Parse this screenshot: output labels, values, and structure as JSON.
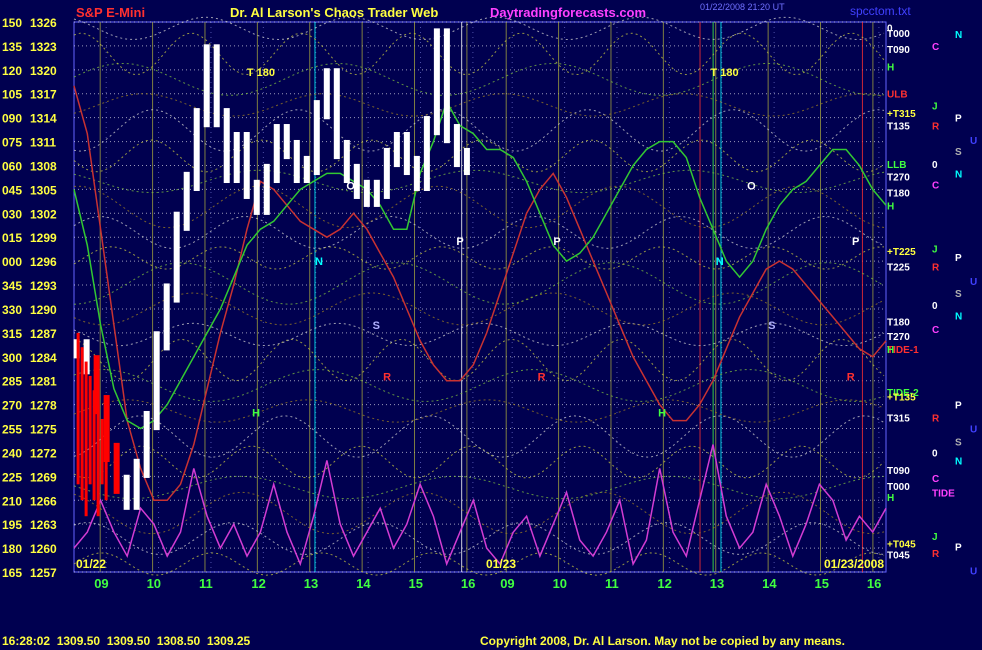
{
  "header": {
    "symbol": "S&P E-Mini",
    "title": "Dr. Al Larson's Chaos Trader Web",
    "site": "Daytradingforecasts.com",
    "timestamp": "01/22/2008 21:20 UT",
    "file": "spcctom.txt"
  },
  "footer": {
    "quote": "16:28:02  1309.50  1309.50  1308.50  1309.25",
    "copyright": "Copyright 2008, Dr. Al Larson. May not be copied by any means."
  },
  "colors": {
    "background": "#000050",
    "grid_vertical": "#B4B43C",
    "grid_horizontal": "#FFFFFF",
    "price_bars": "#FFFFFF",
    "down_bars": "#FF0000",
    "ulb_line": "#C83232",
    "llb_line": "#32C832",
    "tide_line": "#D23CD2"
  },
  "chart_data": {
    "type": "line",
    "title": "S&P E-Mini",
    "ylim": [
      1257,
      1326
    ],
    "y_ticks": [
      {
        "angle": "165",
        "price": "1257"
      },
      {
        "angle": "180",
        "price": "1260"
      },
      {
        "angle": "195",
        "price": "1263"
      },
      {
        "angle": "210",
        "price": "1266"
      },
      {
        "angle": "225",
        "price": "1269"
      },
      {
        "angle": "240",
        "price": "1272"
      },
      {
        "angle": "255",
        "price": "1275"
      },
      {
        "angle": "270",
        "price": "1278"
      },
      {
        "angle": "285",
        "price": "1281"
      },
      {
        "angle": "300",
        "price": "1284"
      },
      {
        "angle": "315",
        "price": "1287"
      },
      {
        "angle": "330",
        "price": "1290"
      },
      {
        "angle": "345",
        "price": "1293"
      },
      {
        "angle": "000",
        "price": "1296"
      },
      {
        "angle": "015",
        "price": "1299"
      },
      {
        "angle": "030",
        "price": "1302"
      },
      {
        "angle": "045",
        "price": "1305"
      },
      {
        "angle": "060",
        "price": "1308"
      },
      {
        "angle": "075",
        "price": "1311"
      },
      {
        "angle": "090",
        "price": "1314"
      },
      {
        "angle": "105",
        "price": "1317"
      },
      {
        "angle": "120",
        "price": "1320"
      },
      {
        "angle": "135",
        "price": "1323"
      },
      {
        "angle": "150",
        "price": "1326"
      }
    ],
    "x_hours": [
      9,
      10,
      11,
      12,
      13,
      14,
      15,
      16,
      9,
      10,
      11,
      12,
      13,
      14,
      15,
      16
    ],
    "x_tick_labels": [
      "09",
      "10",
      "11",
      "12",
      "13",
      "14",
      "15",
      "16",
      "09",
      "10",
      "11",
      "12",
      "13",
      "14",
      "15",
      "16"
    ],
    "date_labels": [
      "01/22",
      "01/23",
      "01/23/2008"
    ],
    "series": [
      {
        "name": "ULB",
        "values": [
          1318,
          1312,
          1300,
          1288,
          1276,
          1270,
          1266,
          1266,
          1268,
          1273,
          1280,
          1287,
          1293,
          1300,
          1306,
          1305,
          1303,
          1301,
          1300,
          1299,
          1300,
          1302,
          1300,
          1297,
          1294,
          1290,
          1286,
          1283,
          1281,
          1281,
          1283,
          1287,
          1292,
          1297,
          1302,
          1305,
          1307,
          1304,
          1300,
          1296,
          1292,
          1288,
          1284,
          1281,
          1278,
          1276,
          1276,
          1278,
          1281,
          1285,
          1289,
          1292,
          1295,
          1296,
          1295,
          1293,
          1291,
          1289,
          1287,
          1285,
          1284,
          1286
        ]
      },
      {
        "name": "LLB",
        "values": [
          1305,
          1298,
          1288,
          1280,
          1276,
          1275,
          1276,
          1278,
          1281,
          1284,
          1287,
          1290,
          1294,
          1298,
          1300,
          1301,
          1303,
          1305,
          1306,
          1307,
          1307,
          1306,
          1305,
          1303,
          1300,
          1300,
          1307,
          1311,
          1316,
          1313,
          1312,
          1310,
          1310,
          1309,
          1306,
          1302,
          1298,
          1296,
          1297,
          1299,
          1302,
          1305,
          1308,
          1310,
          1311,
          1311,
          1309,
          1304,
          1300,
          1296,
          1294,
          1296,
          1300,
          1303,
          1305,
          1306,
          1308,
          1310,
          1310,
          1308,
          1305,
          1303
        ]
      },
      {
        "name": "TIDE",
        "values": [
          1260,
          1262,
          1266,
          1262,
          1259,
          1265,
          1263,
          1259,
          1262,
          1270,
          1264,
          1260,
          1263,
          1259,
          1262,
          1268,
          1262,
          1258,
          1264,
          1271,
          1263,
          1259,
          1262,
          1265,
          1260,
          1263,
          1268,
          1264,
          1258,
          1262,
          1266,
          1260,
          1258,
          1262,
          1264,
          1259,
          1263,
          1267,
          1261,
          1259,
          1262,
          1266,
          1258,
          1261,
          1270,
          1262,
          1259,
          1266,
          1273,
          1264,
          1260,
          1262,
          1268,
          1264,
          1259,
          1263,
          1268,
          1266,
          1261,
          1264,
          1262,
          1265
        ]
      },
      {
        "name": "Price",
        "values": [
          1285,
          1283,
          1278,
          1272,
          1268,
          1266,
          1270,
          1276,
          1286,
          1292,
          1301,
          1306,
          1314,
          1322,
          1314,
          1307,
          1311,
          1305,
          1303,
          1307,
          1312,
          1310,
          1307,
          1308,
          1315,
          1319,
          1310,
          1307,
          1305,
          1304,
          1305,
          1309,
          1311,
          1308,
          1306,
          1313,
          1324,
          1312,
          1309,
          1308
        ]
      }
    ]
  },
  "right_labels": [
    {
      "text": "0",
      "price": 1325.3,
      "col": "a"
    },
    {
      "text": "N",
      "price": 1324.5,
      "col": "c"
    },
    {
      "text": "T000",
      "price": 1324.6,
      "col": "a"
    },
    {
      "text": "C",
      "price": 1323.0,
      "col": "b"
    },
    {
      "text": "T090",
      "price": 1322.6,
      "col": "a"
    },
    {
      "text": "H",
      "price": 1320.4,
      "col": "a"
    },
    {
      "text": "ULB",
      "price": 1317.0,
      "col": "a"
    },
    {
      "text": "J",
      "price": 1315.5,
      "col": "b"
    },
    {
      "text": "+T315",
      "price": 1314.6,
      "col": "a"
    },
    {
      "text": "P",
      "price": 1314.0,
      "col": "c"
    },
    {
      "text": "T135",
      "price": 1313.0,
      "col": "a"
    },
    {
      "text": "R",
      "price": 1313.0,
      "col": "b"
    },
    {
      "text": "U",
      "price": 1311.2,
      "col": "d"
    },
    {
      "text": "S",
      "price": 1309.8,
      "col": "c"
    },
    {
      "text": "LLB",
      "price": 1308.2,
      "col": "a"
    },
    {
      "text": "0",
      "price": 1308.2,
      "col": "b"
    },
    {
      "text": "N",
      "price": 1307.0,
      "col": "c"
    },
    {
      "text": "T270",
      "price": 1306.6,
      "col": "a"
    },
    {
      "text": "C",
      "price": 1305.6,
      "col": "b"
    },
    {
      "text": "T180",
      "price": 1304.6,
      "col": "a"
    },
    {
      "text": "H",
      "price": 1303.0,
      "col": "a"
    },
    {
      "text": "+T225",
      "price": 1297.3,
      "col": "a"
    },
    {
      "text": "J",
      "price": 1297.6,
      "col": "b"
    },
    {
      "text": "P",
      "price": 1296.5,
      "col": "c"
    },
    {
      "text": "T225",
      "price": 1295.3,
      "col": "a"
    },
    {
      "text": "R",
      "price": 1295.3,
      "col": "b"
    },
    {
      "text": "U",
      "price": 1293.5,
      "col": "d"
    },
    {
      "text": "S",
      "price": 1292.0,
      "col": "c"
    },
    {
      "text": "0",
      "price": 1290.5,
      "col": "b"
    },
    {
      "text": "N",
      "price": 1289.2,
      "col": "c"
    },
    {
      "text": "T180",
      "price": 1288.4,
      "col": "a"
    },
    {
      "text": "C",
      "price": 1287.5,
      "col": "b"
    },
    {
      "text": "T270",
      "price": 1286.6,
      "col": "a"
    },
    {
      "text": "TIDE-1",
      "price": 1285.0,
      "col": "a"
    },
    {
      "text": "H",
      "price": 1285.0,
      "col": "a"
    },
    {
      "text": "TIDE-2",
      "price": 1279.6,
      "col": "a"
    },
    {
      "text": "+T135",
      "price": 1279.0,
      "col": "a"
    },
    {
      "text": "P",
      "price": 1278.0,
      "col": "c"
    },
    {
      "text": "T315",
      "price": 1276.4,
      "col": "a"
    },
    {
      "text": "R",
      "price": 1276.4,
      "col": "b"
    },
    {
      "text": "U",
      "price": 1275.0,
      "col": "d"
    },
    {
      "text": "S",
      "price": 1273.4,
      "col": "c"
    },
    {
      "text": "0",
      "price": 1272.0,
      "col": "b"
    },
    {
      "text": "N",
      "price": 1271.0,
      "col": "c"
    },
    {
      "text": "T090",
      "price": 1269.8,
      "col": "a"
    },
    {
      "text": "C",
      "price": 1268.8,
      "col": "b"
    },
    {
      "text": "T000",
      "price": 1267.8,
      "col": "a"
    },
    {
      "text": "TIDE",
      "price": 1267.0,
      "col": "b"
    },
    {
      "text": "H",
      "price": 1266.4,
      "col": "a"
    },
    {
      "text": "J",
      "price": 1261.5,
      "col": "b"
    },
    {
      "text": "+T045",
      "price": 1260.6,
      "col": "a"
    },
    {
      "text": "P",
      "price": 1260.2,
      "col": "c"
    },
    {
      "text": "T045",
      "price": 1259.2,
      "col": "a"
    },
    {
      "text": "R",
      "price": 1259.4,
      "col": "b"
    },
    {
      "text": "U",
      "price": 1257.2,
      "col": "d"
    }
  ],
  "in_chart_labels": [
    {
      "text": "T 180",
      "hour": 11.8,
      "price": 1319.2
    },
    {
      "text": "T 180",
      "hour": 12.9,
      "price": 1319.2,
      "day": 2
    },
    {
      "text": "O",
      "hour": 13.7,
      "price": 1305.0
    },
    {
      "text": "O",
      "hour": 13.6,
      "price": 1305.0,
      "day": 2
    },
    {
      "text": "N",
      "hour": 13.1,
      "price": 1295.5
    },
    {
      "text": "N",
      "hour": 13.0,
      "price": 1295.5,
      "day": 2
    },
    {
      "text": "P",
      "hour": 15.8,
      "price": 1298.0
    },
    {
      "text": "P",
      "hour": 9.9,
      "price": 1298.0,
      "day": 2
    },
    {
      "text": "P",
      "hour": 15.6,
      "price": 1298.0,
      "day": 2
    },
    {
      "text": "S",
      "hour": 14.2,
      "price": 1287.5
    },
    {
      "text": "S",
      "hour": 14.0,
      "price": 1287.5,
      "day": 2
    },
    {
      "text": "H",
      "hour": 11.9,
      "price": 1276.5
    },
    {
      "text": "H",
      "hour": 11.9,
      "price": 1276.5,
      "day": 2
    },
    {
      "text": "R",
      "hour": 14.4,
      "price": 1281.0
    },
    {
      "text": "R",
      "hour": 9.6,
      "price": 1281.0,
      "day": 2
    },
    {
      "text": "R",
      "hour": 15.5,
      "price": 1281.0,
      "day": 2
    }
  ]
}
